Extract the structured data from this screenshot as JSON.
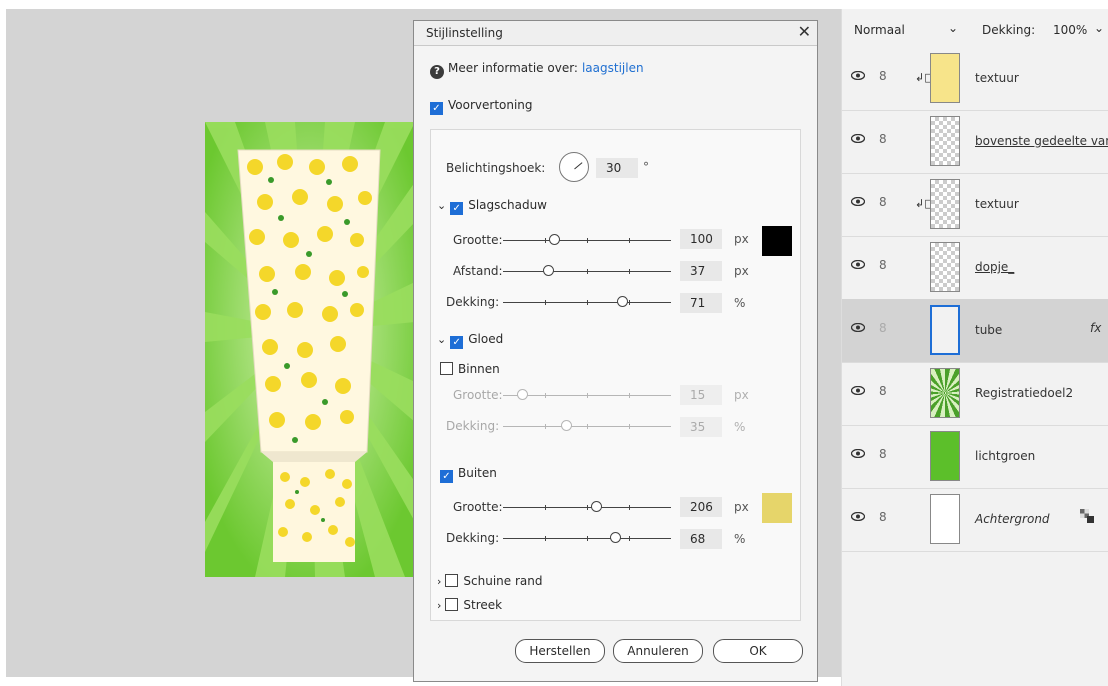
{
  "dialog": {
    "title": "Stijlinstelling",
    "info_label": "Meer informatie over:",
    "info_link": "laagstijlen",
    "preview_label": "Voorvertoning",
    "angle_label": "Belichtingshoek:",
    "angle_value": "30",
    "angle_unit": "°",
    "slagschaduw": {
      "label": "Slagschaduw",
      "size_label": "Grootte:",
      "size_value": "100",
      "size_unit": "px",
      "distance_label": "Afstand:",
      "distance_value": "37",
      "distance_unit": "px",
      "opacity_label": "Dekking:",
      "opacity_value": "71",
      "opacity_unit": "%",
      "color": "#000000"
    },
    "gloed": {
      "label": "Gloed",
      "binnen": {
        "label": "Binnen",
        "size_label": "Grootte:",
        "size_value": "15",
        "size_unit": "px",
        "opacity_label": "Dekking:",
        "opacity_value": "35",
        "opacity_unit": "%"
      },
      "buiten": {
        "label": "Buiten",
        "size_label": "Grootte:",
        "size_value": "206",
        "size_unit": "px",
        "opacity_label": "Dekking:",
        "opacity_value": "68",
        "opacity_unit": "%",
        "color": "#e6d56a"
      }
    },
    "schuine_rand_label": "Schuine rand",
    "streek_label": "Streek",
    "buttons": {
      "reset": "Herstellen",
      "cancel": "Annuleren",
      "ok": "OK"
    }
  },
  "layers_panel": {
    "blend_mode": "Normaal",
    "opacity_label": "Dekking:",
    "opacity_value": "100%",
    "layers": [
      {
        "name": "textuur",
        "thumb": "yellow",
        "clip": true,
        "selected": false
      },
      {
        "name": "bovenste gedeelte van t...",
        "thumb": "checker",
        "clip": false,
        "selected": false
      },
      {
        "name": "textuur",
        "thumb": "checker",
        "clip": true,
        "selected": false
      },
      {
        "name": "dopje_",
        "thumb": "checker",
        "clip": false,
        "selected": false
      },
      {
        "name": "tube",
        "thumb": "tube",
        "clip": false,
        "selected": true,
        "fx": "fx"
      },
      {
        "name": "Registratiedoel2",
        "thumb": "rays",
        "clip": false,
        "selected": false
      },
      {
        "name": "lichtgroen",
        "thumb": "green",
        "clip": false,
        "selected": false
      },
      {
        "name": "Achtergrond",
        "thumb": "white",
        "clip": false,
        "selected": false,
        "locked": true
      }
    ]
  },
  "colors": {
    "accent": "#1e6ed6",
    "link": "#1f6fd1",
    "artwork_green": "#7fd23f",
    "lichtgroen": "#5cbf2a"
  }
}
